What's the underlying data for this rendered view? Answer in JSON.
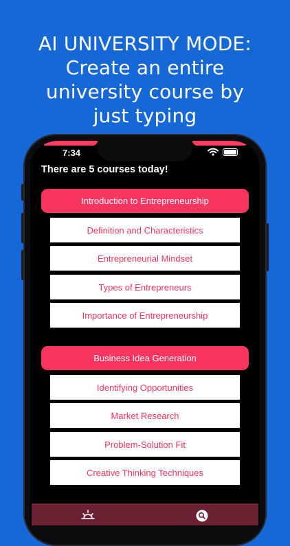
{
  "promo": {
    "line1": "AI UNIVERSITY MODE:",
    "line2": "Create an entire",
    "line3": "university course by",
    "line4": "just typing"
  },
  "status_bar": {
    "time": "7:34"
  },
  "main": {
    "heading": "There are 5 courses today!",
    "courses": [
      {
        "title": "Introduction to Entrepreneurship",
        "topics": [
          "Definition and Characteristics",
          "Entrepreneurial Mindset",
          "Types of Entrepreneurs",
          "Importance of Entrepreneurship"
        ]
      },
      {
        "title": "Business Idea Generation",
        "topics": [
          "Identifying Opportunities",
          "Market Research",
          "Problem-Solution Fit",
          "Creative Thinking Techniques"
        ]
      }
    ]
  },
  "tab_bar": {
    "left_icon": "sunrise-icon",
    "right_icon": "search-icon"
  },
  "colors": {
    "background": "#1668D6",
    "accent": "#F7355E",
    "screen": "#000000",
    "tab_bar": "#6B2233"
  }
}
